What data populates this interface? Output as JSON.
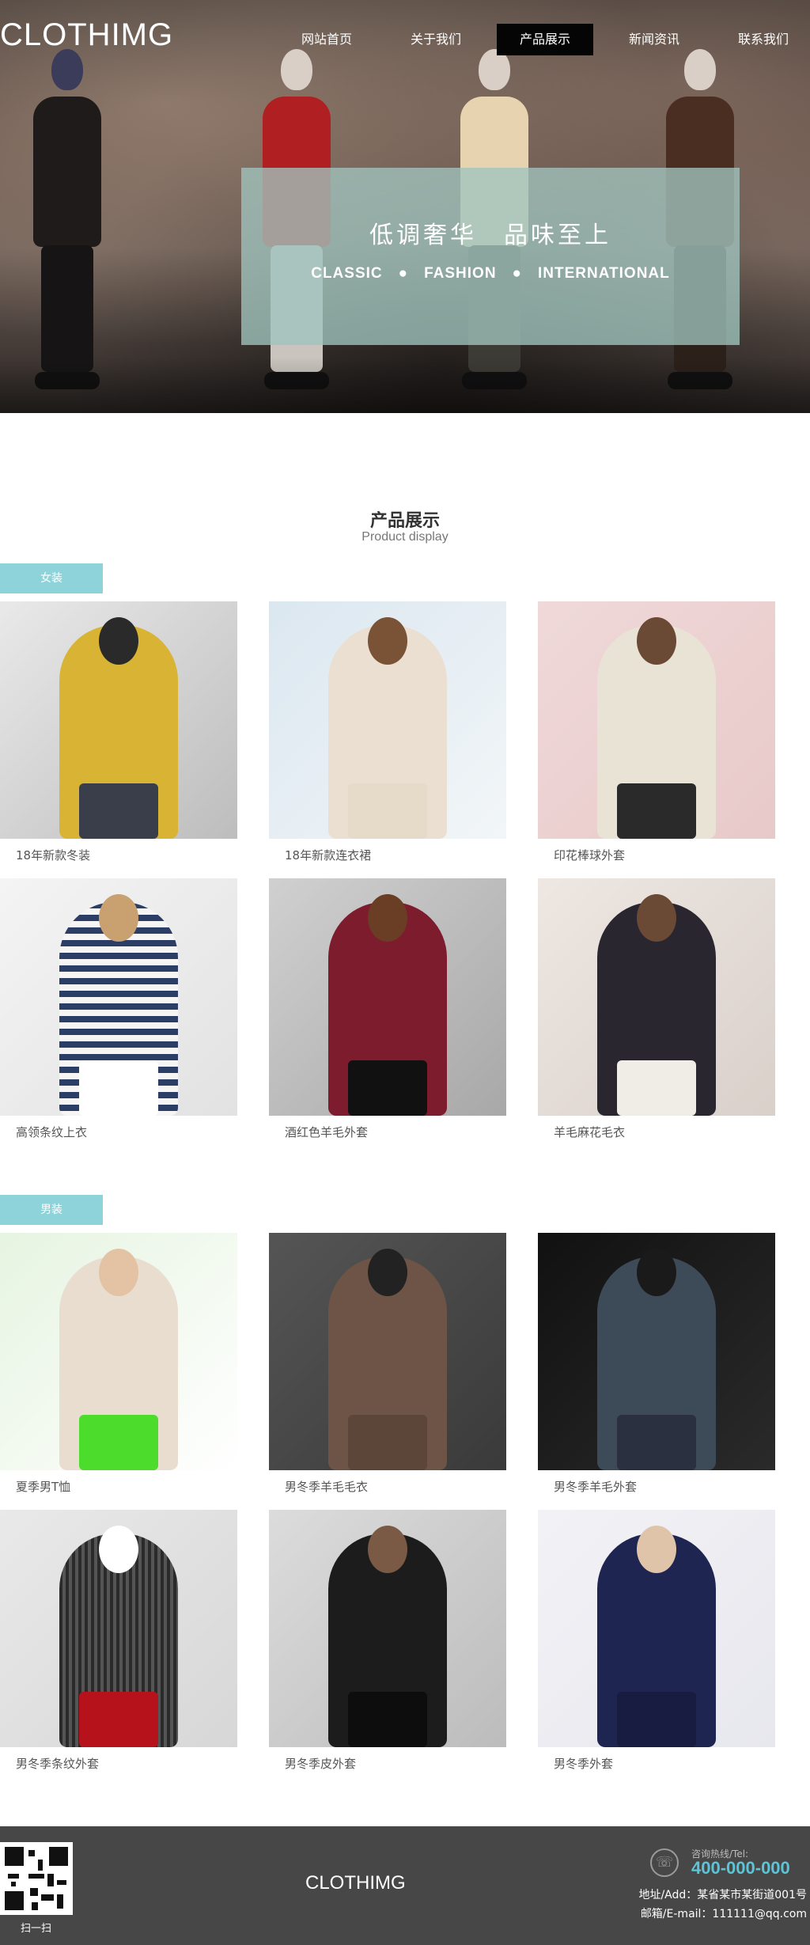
{
  "header": {
    "logo": "CLOTHIMG",
    "nav": [
      "网站首页",
      "关于我们",
      "产品展示",
      "新闻资讯",
      "联系我们"
    ],
    "active_index": 2
  },
  "banner": {
    "title_cn": "低调奢华　品味至上",
    "subtitle_en": "CLASSIC　●　FASHION　●　INTERNATIONAL"
  },
  "section": {
    "title": "产品展示",
    "subtitle": "Product display"
  },
  "categories": [
    {
      "name": "女装",
      "products": [
        {
          "name": "18年新款冬装"
        },
        {
          "name": "18年新款连衣裙"
        },
        {
          "name": "印花棒球外套"
        },
        {
          "name": "高领条纹上衣"
        },
        {
          "name": "酒红色羊毛外套"
        },
        {
          "name": "羊毛麻花毛衣"
        }
      ]
    },
    {
      "name": "男装",
      "products": [
        {
          "name": "夏季男T恤"
        },
        {
          "name": "男冬季羊毛毛衣"
        },
        {
          "name": "男冬季羊毛外套"
        },
        {
          "name": "男冬季条纹外套"
        },
        {
          "name": "男冬季皮外套"
        },
        {
          "name": "男冬季外套"
        }
      ]
    }
  ],
  "footer": {
    "qr_caption": "扫一扫",
    "brand": "CLOTHIMG",
    "hotline_label": "咨询热线/Tel:",
    "hotline_number": "400-000-000",
    "address": "地址/Add：某省某市某街道001号",
    "email": "邮箱/E-mail：111111@qq.com"
  },
  "colors": {
    "accent": "#8fd3da",
    "banner_overlay": "#a0c4be",
    "footer_bg": "#474747",
    "hotline": "#5cc4d6"
  }
}
